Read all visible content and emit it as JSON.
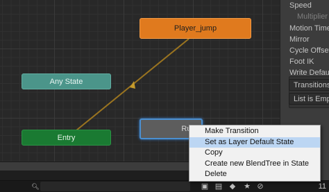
{
  "graph": {
    "states": {
      "player_jump": "Player_jump",
      "any_state": "Any State",
      "entry": "Entry",
      "selected_state": "Run"
    }
  },
  "inspector": {
    "speed": "Speed",
    "multiplier": "Multiplier",
    "motion_time": "Motion Time",
    "mirror": "Mirror",
    "cycle_offset": "Cycle Offset",
    "foot_ik": "Foot IK",
    "write_defaults": "Write Defaults",
    "transitions": "Transitions",
    "list_empty": "List is Empty"
  },
  "context_menu": {
    "items": [
      {
        "label": "Make Transition"
      },
      {
        "label": "Set as Layer Default State"
      },
      {
        "label": "Copy"
      },
      {
        "label": "Create new BlendTree in State"
      },
      {
        "label": "Delete"
      }
    ]
  },
  "statusbar": {
    "search_placeholder": "",
    "hidden_count": "11"
  },
  "colors": {
    "jump_node": "#e07a1e",
    "any_state_node": "#4b958a",
    "entry_node": "#1a7a32",
    "selection_outline": "#4a8fd1",
    "menu_highlight": "#bcd6f3"
  },
  "icons": {
    "search": "search-icon",
    "layers": "layers-icon",
    "tag": "tag-icon",
    "star": "star-icon",
    "eye_off": "eye-off-icon"
  }
}
